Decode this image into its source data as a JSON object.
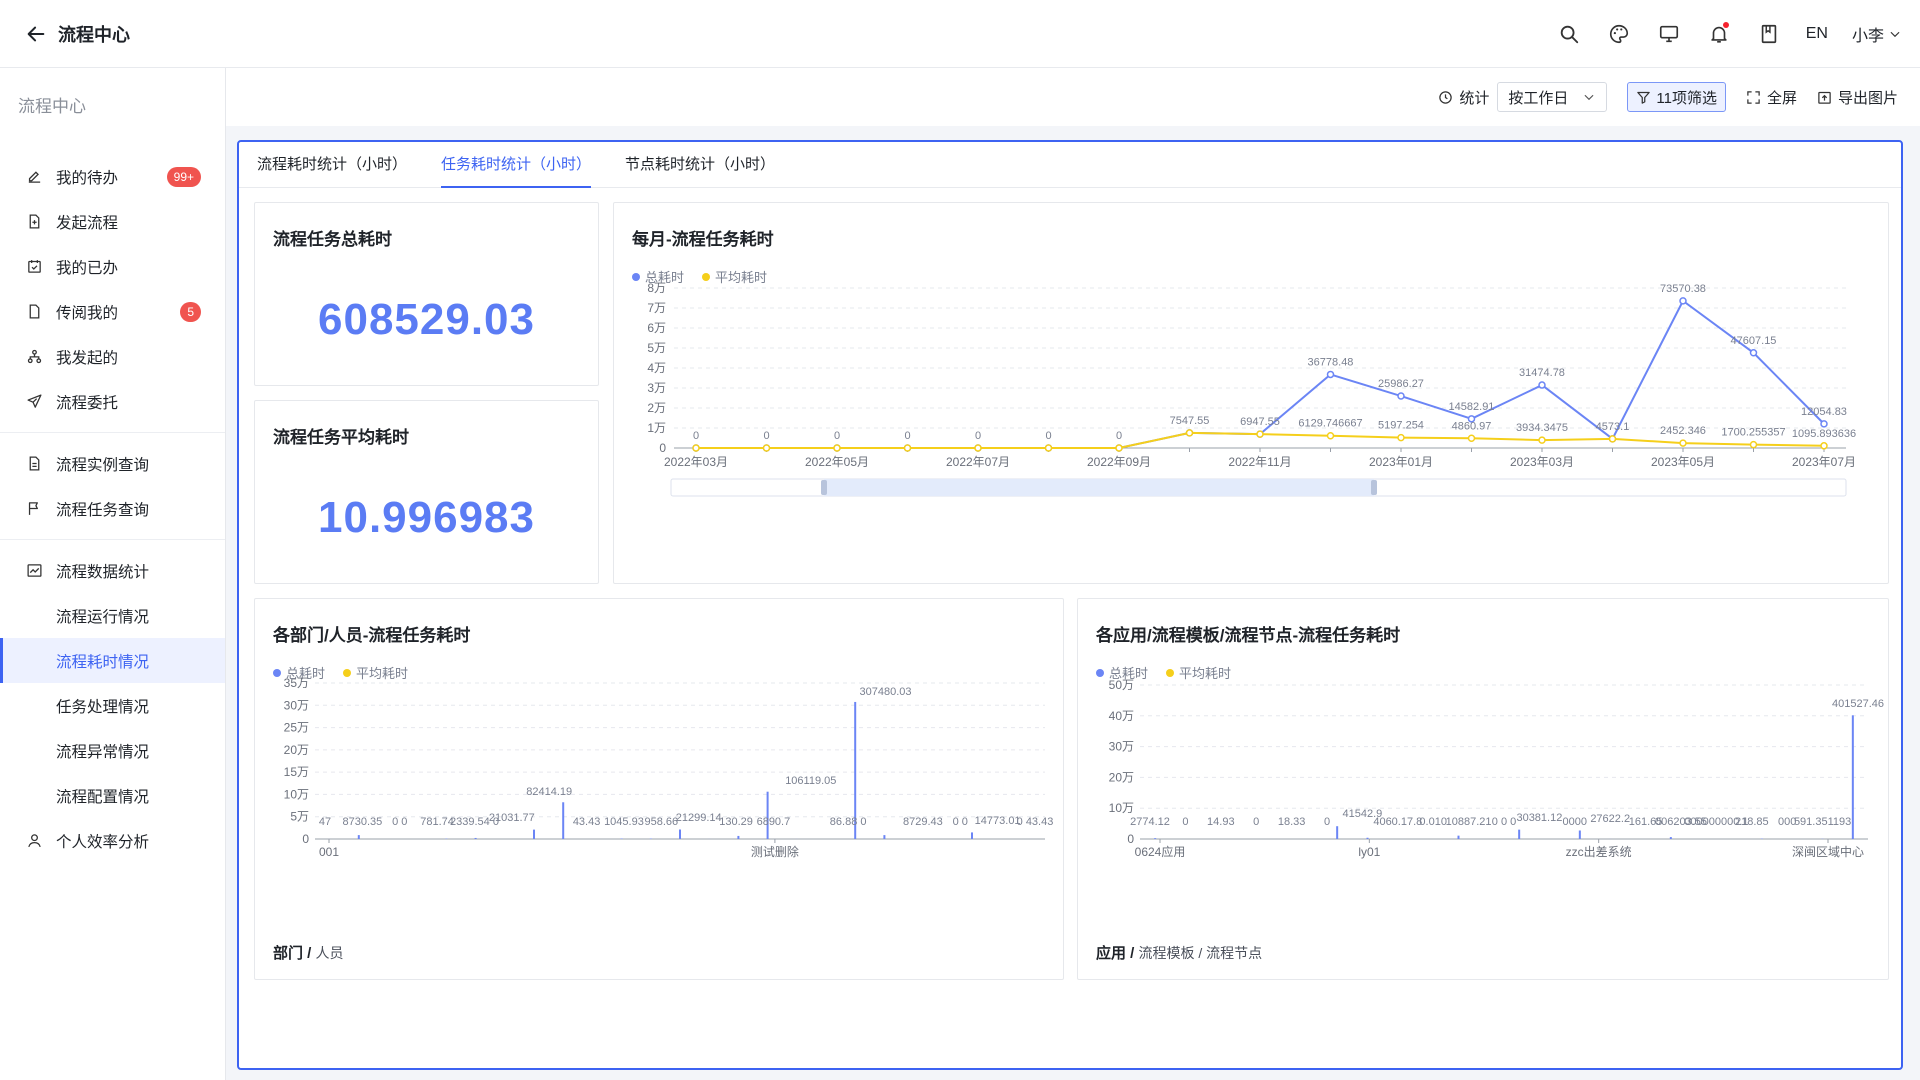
{
  "app": {
    "title": "流程中心"
  },
  "header": {
    "lang": "EN",
    "user": "小李"
  },
  "sidebar": {
    "title": "流程中心",
    "group1": [
      {
        "label": "我的待办",
        "badge": "99+"
      },
      {
        "label": "发起流程"
      },
      {
        "label": "我的已办"
      },
      {
        "label": "传阅我的",
        "badge": "5"
      },
      {
        "label": "我发起的"
      },
      {
        "label": "流程委托"
      }
    ],
    "group2": [
      {
        "label": "流程实例查询"
      },
      {
        "label": "流程任务查询"
      }
    ],
    "group3": {
      "label": "流程数据统计",
      "children": [
        "流程运行情况",
        "流程耗时情况",
        "任务处理情况",
        "流程异常情况",
        "流程配置情况"
      ]
    },
    "extra": "个人效率分析"
  },
  "toolbar": {
    "stat_label": "统计",
    "select_value": "按工作日",
    "filter_label": "11项筛选",
    "fullscreen": "全屏",
    "export": "导出图片"
  },
  "tabs": [
    "流程耗时统计（小时）",
    "任务耗时统计（小时）",
    "节点耗时统计（小时）"
  ],
  "kpi": {
    "total_title": "流程任务总耗时",
    "total_value": "608529.03",
    "avg_title": "流程任务平均耗时",
    "avg_value": "10.996983"
  },
  "colors": {
    "total": "#6b85f5",
    "avg": "#f5cf1b",
    "accent": "#3d63f2"
  },
  "chart_data": [
    {
      "type": "line",
      "title": "每月-流程任务耗时",
      "legend": [
        "总耗时",
        "平均耗时"
      ],
      "x": [
        "2022年03月",
        "2022年04月",
        "2022年05月",
        "2022年06月",
        "2022年07月",
        "2022年08月",
        "2022年09月",
        "2022年10月",
        "2022年11月",
        "2022年12月",
        "2023年01月",
        "2023年02月",
        "2023年03月",
        "2023年04月",
        "2023年05月",
        "2023年06月",
        "2023年07月"
      ],
      "x_tick_labels": [
        "2022年03月",
        "2022年05月",
        "2022年07月",
        "2022年09月",
        "2022年11月",
        "2023年01月",
        "2023年03月",
        "2023年05月",
        "2023年07月"
      ],
      "y_tick_labels": [
        "0",
        "1万",
        "2万",
        "3万",
        "4万",
        "5万",
        "6万",
        "7万",
        "8万"
      ],
      "ylim": [
        0,
        80000
      ],
      "series": [
        {
          "name": "总耗时",
          "values": [
            0,
            0,
            0,
            0,
            0,
            0,
            0,
            7547.55,
            6947.55,
            36778.48,
            25986.27,
            14582.91,
            31474.78,
            4573.1,
            73570.38,
            47607.15,
            12054.83
          ],
          "labels": [
            "0",
            "0",
            "0",
            "0",
            "0",
            "0",
            "0",
            "7547.55",
            "6947.55",
            "36778.48",
            "25986.27",
            "14582.91",
            "31474.78",
            "4573.1",
            "73570.38",
            "47607.15",
            "12054.83"
          ]
        },
        {
          "name": "平均耗时",
          "values": [
            0,
            0,
            0,
            0,
            0,
            0,
            0,
            7547.55,
            6947.55,
            6129.746667,
            5197.254,
            4860.97,
            3934.3475,
            4573.1,
            2452.346,
            1700.255357,
            1095.893636
          ],
          "labels": [
            "",
            "",
            "",
            "",
            "",
            "",
            "",
            "",
            "",
            "6129.746667",
            "5197.254",
            "4860.97",
            "3934.3475",
            "",
            "2452.346",
            "1700.255357",
            "1095.893636"
          ]
        }
      ]
    },
    {
      "type": "bar",
      "title": "各部门/人员-流程任务耗时",
      "legend": [
        "总耗时",
        "平均耗时"
      ],
      "x_tick_labels": [
        "001",
        "测试删除"
      ],
      "y_tick_labels": [
        "0",
        "5万",
        "10万",
        "15万",
        "20万",
        "25万",
        "30万",
        "35万"
      ],
      "ylim": [
        0,
        350000
      ],
      "bar_values": [
        47,
        8730.35,
        0,
        0,
        781.74,
        2339.54,
        0,
        21031.77,
        82414.19,
        43.43,
        1045.93,
        958.66,
        21299.14,
        130.29,
        6890.7,
        106119.05,
        86.88,
        0,
        307480.03,
        8729.43,
        0,
        0,
        14773.01,
        0,
        43.43
      ],
      "value_labels": [
        "47",
        "8730.35",
        "0 0",
        "781.74",
        "2339.54 0",
        "21031.77",
        "82414.19",
        "43.43",
        "1045.93",
        "958.66",
        "21299.14",
        "130.29",
        "6890.7",
        "106119.05",
        "86.88 0",
        "307480.03",
        "8729.43",
        "0 0",
        "14773.01",
        "0 43.43"
      ],
      "footer_bold": "部门 /",
      "footer_sub": "人员"
    },
    {
      "type": "bar",
      "title": "各应用/流程模板/流程节点-流程任务耗时",
      "legend": [
        "总耗时",
        "平均耗时"
      ],
      "x_tick_labels": [
        "0624应用",
        "ly01",
        "zzc出差系统",
        "深闽区域中心"
      ],
      "y_tick_labels": [
        "0",
        "10万",
        "20万",
        "30万",
        "40万",
        "50万"
      ],
      "ylim": [
        0,
        500000
      ],
      "bar_values": [
        2774.12,
        0,
        14.93,
        0,
        18.33,
        0,
        41542.9,
        4060.17,
        8,
        0,
        10887.21,
        0,
        30381.12,
        0,
        27622.2,
        161.65,
        0,
        6203.55,
        0,
        0,
        1218.85,
        0,
        591.35,
        401527.46
      ],
      "value_labels": [
        "2774.12",
        "0",
        "14.93",
        "0",
        "18.33",
        "0",
        "41542.9",
        "4060.17.8",
        "0.010",
        "10887.21",
        "0 0 0",
        "30381.12",
        "0000",
        "27622.2",
        "161.65",
        "006203.55",
        "000000000.1",
        "218.85",
        "000",
        "591.351193",
        "401527.46"
      ],
      "footer_bold": "应用 /",
      "footer_sub": "流程模板 / 流程节点"
    }
  ]
}
